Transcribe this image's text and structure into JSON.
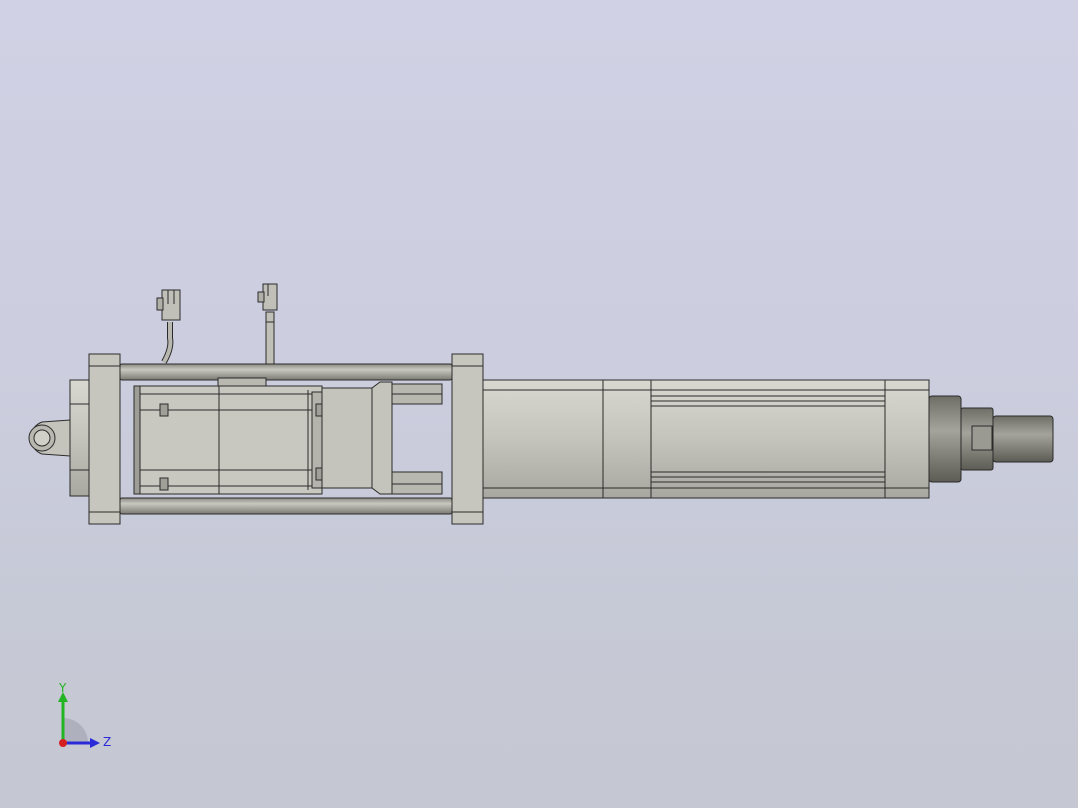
{
  "viewport": {
    "background_top": "#d0d1e4",
    "background_bottom": "#c5c8d2"
  },
  "model": {
    "body_color": "#c6c6be",
    "shadow_color": "#9c9c94",
    "edge_color": "#2a2a2a"
  },
  "triad": {
    "y_label": "Y",
    "z_label": "Z",
    "y_color": "#22b422",
    "z_color": "#2a2ad8",
    "x_color": "#d42020"
  }
}
